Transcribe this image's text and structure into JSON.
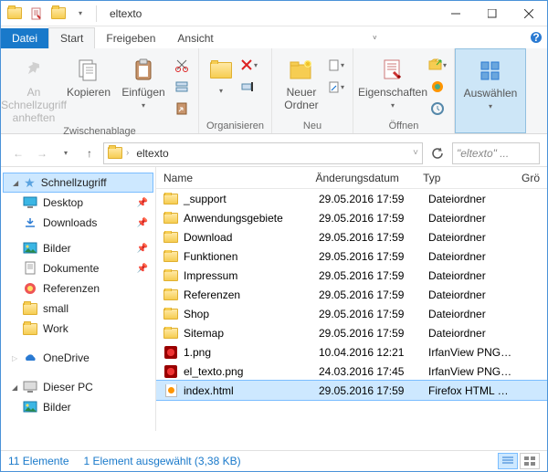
{
  "title": "eltexto",
  "tabs": {
    "file": "Datei",
    "start": "Start",
    "share": "Freigeben",
    "view": "Ansicht"
  },
  "ribbon": {
    "pin": "An Schnellzugriff anheften",
    "copy": "Kopieren",
    "paste": "Einfügen",
    "clipboard": "Zwischenablage",
    "organize": "Organisieren",
    "newfolder": "Neuer Ordner",
    "new": "Neu",
    "properties": "Eigenschaften",
    "open": "Öffnen",
    "select": "Auswählen"
  },
  "breadcrumb": "eltexto",
  "search_placeholder": "\"eltexto\" ...",
  "columns": {
    "name": "Name",
    "date": "Änderungsdatum",
    "type": "Typ",
    "size": "Grö"
  },
  "nav": {
    "quick": "Schnellzugriff",
    "desktop": "Desktop",
    "downloads": "Downloads",
    "bilder": "Bilder",
    "dokumente": "Dokumente",
    "referenzen": "Referenzen",
    "small": "small",
    "work": "Work",
    "onedrive": "OneDrive",
    "thispc": "Dieser PC",
    "bilder2": "Bilder"
  },
  "types": {
    "folder": "Dateiordner",
    "png": "IrfanView PNG File",
    "html": "Firefox HTML Doc..."
  },
  "files": [
    {
      "name": "_support",
      "date": "29.05.2016 17:59",
      "kind": "folder"
    },
    {
      "name": "Anwendungsgebiete",
      "date": "29.05.2016 17:59",
      "kind": "folder"
    },
    {
      "name": "Download",
      "date": "29.05.2016 17:59",
      "kind": "folder"
    },
    {
      "name": "Funktionen",
      "date": "29.05.2016 17:59",
      "kind": "folder"
    },
    {
      "name": "Impressum",
      "date": "29.05.2016 17:59",
      "kind": "folder"
    },
    {
      "name": "Referenzen",
      "date": "29.05.2016 17:59",
      "kind": "folder"
    },
    {
      "name": "Shop",
      "date": "29.05.2016 17:59",
      "kind": "folder"
    },
    {
      "name": "Sitemap",
      "date": "29.05.2016 17:59",
      "kind": "folder"
    },
    {
      "name": "1.png",
      "date": "10.04.2016 12:21",
      "kind": "png"
    },
    {
      "name": "el_texto.png",
      "date": "24.03.2016 17:45",
      "kind": "png"
    },
    {
      "name": "index.html",
      "date": "29.05.2016 17:59",
      "kind": "html",
      "selected": true
    }
  ],
  "status": {
    "count": "11 Elemente",
    "selected": "1 Element ausgewählt (3,38 KB)"
  }
}
